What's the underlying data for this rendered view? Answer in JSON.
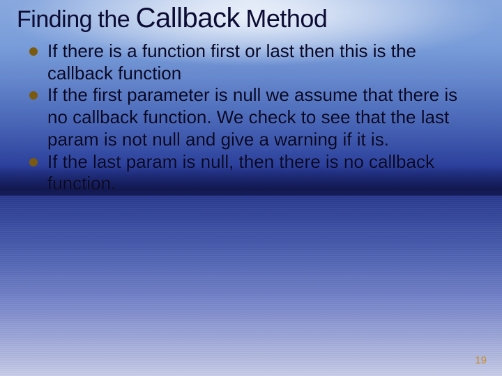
{
  "slide": {
    "title": {
      "w1": "Finding",
      "w2": "the",
      "w3": "Callback",
      "w4": "Method"
    },
    "bullets": [
      "If there is a function first or last then this is the callback function",
      "If the first parameter is null we assume that there is no callback function. We check to see that the last param is not null and give a warning if it is.",
      "If the last param is null, then there is no callback function."
    ],
    "page_number": "19"
  }
}
